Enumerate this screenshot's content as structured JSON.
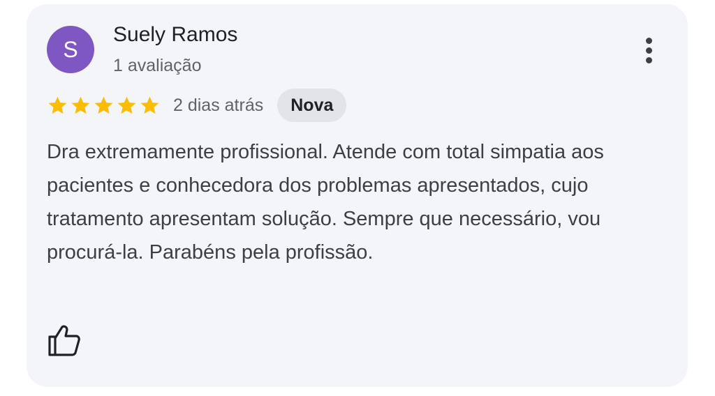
{
  "review": {
    "author_initial": "S",
    "author_name": "Suely Ramos",
    "review_count": "1 avaliação",
    "rating": 5,
    "rating_max": 5,
    "date": "2 dias atrás",
    "badge": "Nova",
    "text": "Dra extremamente profissional. Atende com total simpatia aos pacientes e conhecedora dos problemas apresentados, cujo tratamento apresentam solução. Sempre que necessário, vou procurá-la. Parabéns pela profissão."
  },
  "icons": {
    "more": "more-vertical-icon",
    "star": "star-icon",
    "like": "thumbs-up-icon"
  },
  "colors": {
    "avatar_bg": "#7e57c2",
    "star": "#fbbc04",
    "card_bg": "#f4f5f8",
    "badge_bg": "#e3e4e8"
  }
}
